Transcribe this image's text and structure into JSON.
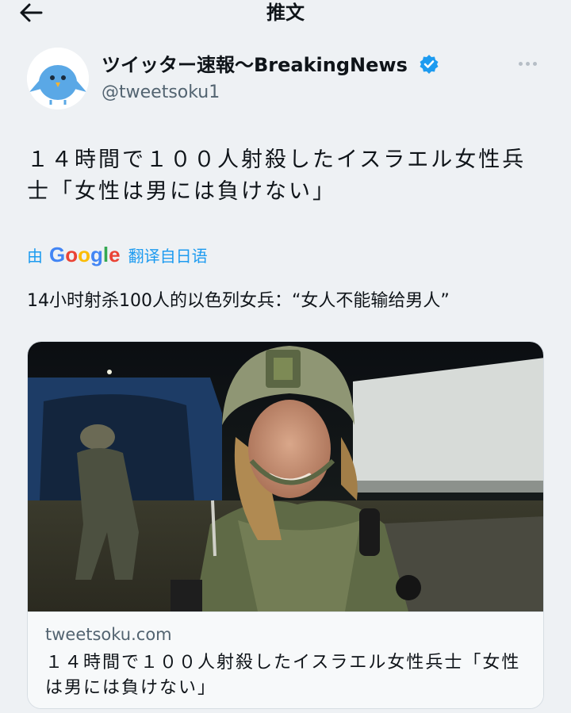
{
  "header": {
    "title": "推文"
  },
  "author": {
    "name": "ツイッター速報〜BreakingNews",
    "handle": "@tweetsoku1"
  },
  "tweet": {
    "text": "１４時間で１００人射殺したイスラエル女性兵士「女性は男には負けない」",
    "translate_by": "由",
    "google_logo": "Google",
    "translate_label": "翻译自日语",
    "translated_text": "14小时射杀100人的以色列女兵：“女人不能输给男人”"
  },
  "card": {
    "domain": "tweetsoku.com",
    "title": "１４時間で１００人射殺したイスラエル女性兵士「女性は男には負けない」"
  },
  "colors": {
    "accent": "#1d9bf0",
    "background": "#eef1f4",
    "text": "#0f1419",
    "muted": "#536471"
  },
  "icons": {
    "back": "arrow-left-icon",
    "verified": "verified-badge-icon",
    "more": "more-horizontal-icon",
    "avatar": "bird-avatar"
  }
}
